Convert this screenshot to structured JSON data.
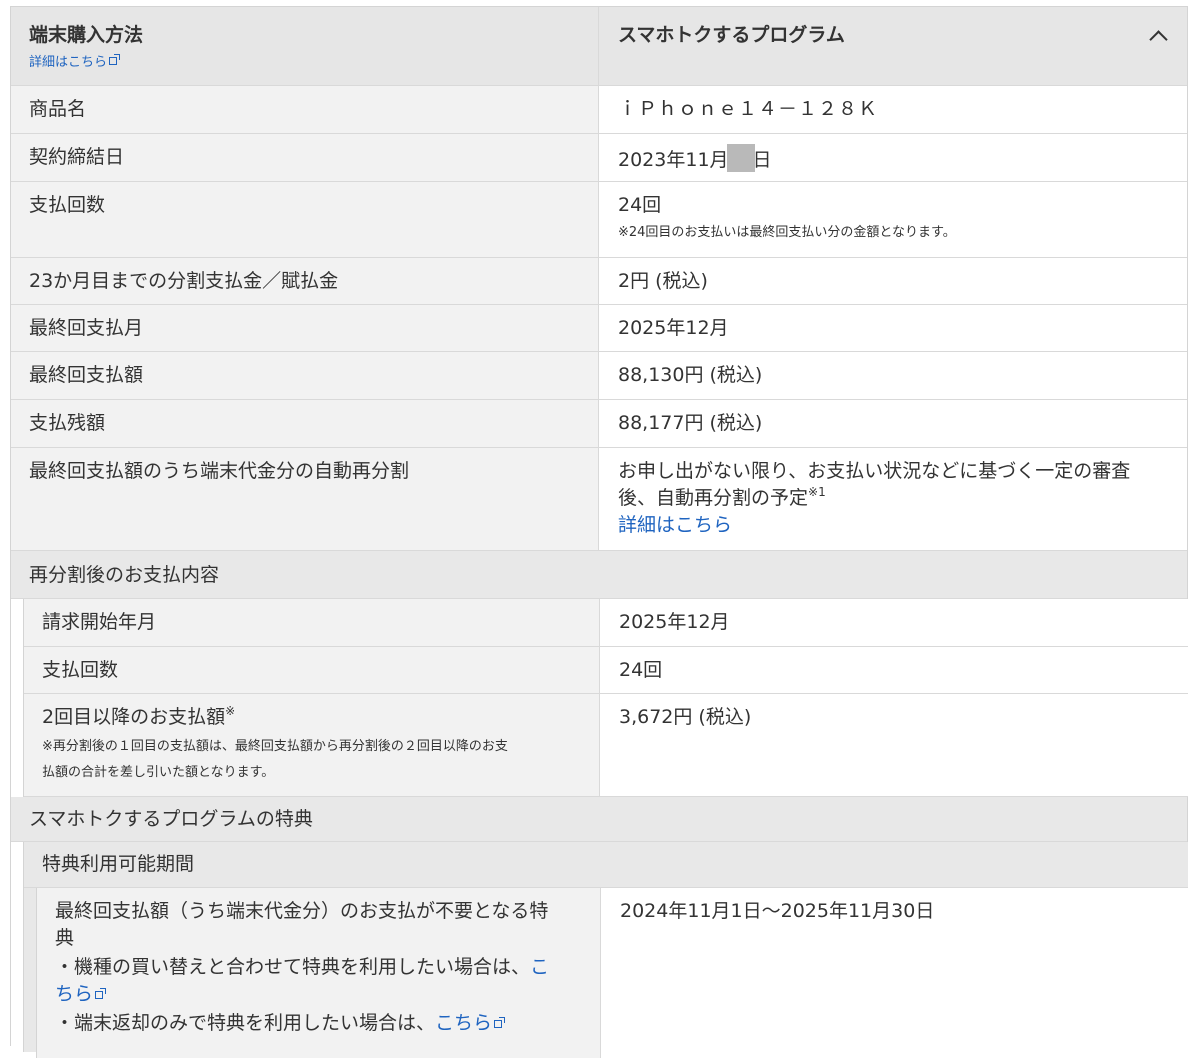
{
  "header": {
    "left_title": "端末購入方法",
    "left_link": "詳細はこちら",
    "right_title": "スマホトクするプログラム"
  },
  "rows": {
    "product": {
      "label": "商品名",
      "value": "ｉＰｈｏｎｅ１４－１２８Ｋ"
    },
    "contract_date": {
      "label": "契約締結日",
      "value_prefix": "2023年11月",
      "value_suffix": "日"
    },
    "payments": {
      "label": "支払回数",
      "value": "24回",
      "note": "※24回目のお支払いは最終回支払い分の金額となります。"
    },
    "installment": {
      "label": "23か月目までの分割支払金／賦払金",
      "value": "2円 (税込)"
    },
    "final_month": {
      "label": "最終回支払月",
      "value": "2025年12月"
    },
    "final_amount": {
      "label": "最終回支払額",
      "value": "88,130円 (税込)"
    },
    "remaining": {
      "label": "支払残額",
      "value": "88,177円 (税込)"
    },
    "auto_resplit": {
      "label": "最終回支払額のうち端末代金分の自動再分割",
      "value_line1": "お申し出がない限り、お支払い状況などに基づく一定の審査",
      "value_line2": "後、自動再分割の予定",
      "value_sup": "※1",
      "link": "詳細はこちら"
    }
  },
  "resplit_section": {
    "title": "再分割後のお支払内容",
    "billing_start": {
      "label": "請求開始年月",
      "value": "2025年12月"
    },
    "payments": {
      "label": "支払回数",
      "value": "24回"
    },
    "second_onward": {
      "label": "2回目以降のお支払額",
      "label_sup": "※",
      "note_line1": "※再分割後の１回目の支払額は、最終回支払額から再分割後の２回目以降のお支",
      "note_line2": "払額の合計を差し引いた額となります。",
      "value": "3,672円 (税込)"
    }
  },
  "benefit_section": {
    "title": "スマホトクするプログラムの特典",
    "period_title": "特典利用可能期間",
    "benefit": {
      "label_line1": "最終回支払額（うち端末代金分）のお支払が不要となる特",
      "label_line2": "典",
      "bullet1_text": "・機種の買い替えと合わせて特典を利用したい場合は、",
      "bullet1_link_a": "こ",
      "bullet1_link_b": "ちら",
      "bullet2_text": "・端末返却のみで特典を利用したい場合は、",
      "bullet2_link": "こちら",
      "value": "2024年11月1日〜2025年11月30日"
    }
  },
  "colors": {
    "link": "#1f64c0",
    "label_bg": "#f2f2f2",
    "header_bg": "#e6e6e6",
    "border": "#d9d9d9"
  },
  "icons": [
    "external-link-icon",
    "chevron-up-icon"
  ]
}
